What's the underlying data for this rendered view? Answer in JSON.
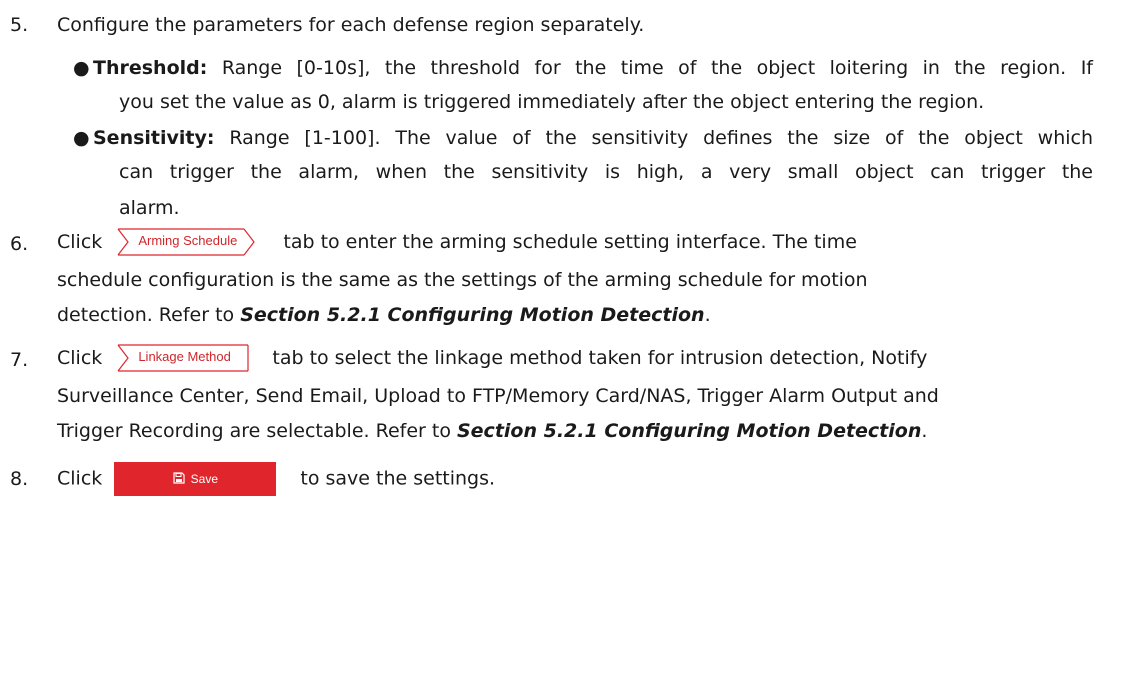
{
  "step5": {
    "num": "5.",
    "text": "Configure the parameters for each defense region separately."
  },
  "threshold": {
    "bullet": "●",
    "label": "Threshold:",
    "line1": " Range [0-10s], the threshold for the time of the object loitering in the region. If",
    "line2": "you set the value as 0, alarm is triggered immediately after the object entering the region."
  },
  "sensitivity": {
    "bullet": "●",
    "label": "Sensitivity:",
    "line1": " Range [1-100]. The value of the sensitivity defines the size of the object which",
    "line2": "can trigger the alarm, when the sensitivity is high, a very small object can trigger the",
    "line3": "alarm."
  },
  "step6": {
    "num": "6.",
    "click": "Click",
    "button": "Arming Schedule",
    "line1": "tab to enter the arming schedule setting interface. The time",
    "line2": "schedule configuration is the same as the settings of the arming schedule for motion",
    "line3_pre": "detection. Refer to ",
    "line3_ref": "Section 5.2.1 Configuring Motion Detection",
    "line3_post": "."
  },
  "step7": {
    "num": "7.",
    "click": "Click",
    "button": "Linkage Method",
    "line1": "tab to select the linkage method taken for intrusion detection, Notify",
    "line2": "Surveillance Center, Send Email, Upload to FTP/Memory Card/NAS, Trigger Alarm Output and",
    "line3_pre": "Trigger Recording are selectable. Refer to ",
    "line3_ref": "Section 5.2.1 Configuring Motion Detection",
    "line3_post": "."
  },
  "step8": {
    "num": "8.",
    "click": "Click",
    "button": "Save",
    "button_icon": "floppy-disk-icon",
    "text": "to save the settings."
  },
  "colors": {
    "accent": "#e0262c",
    "text": "#1a1a1a"
  }
}
